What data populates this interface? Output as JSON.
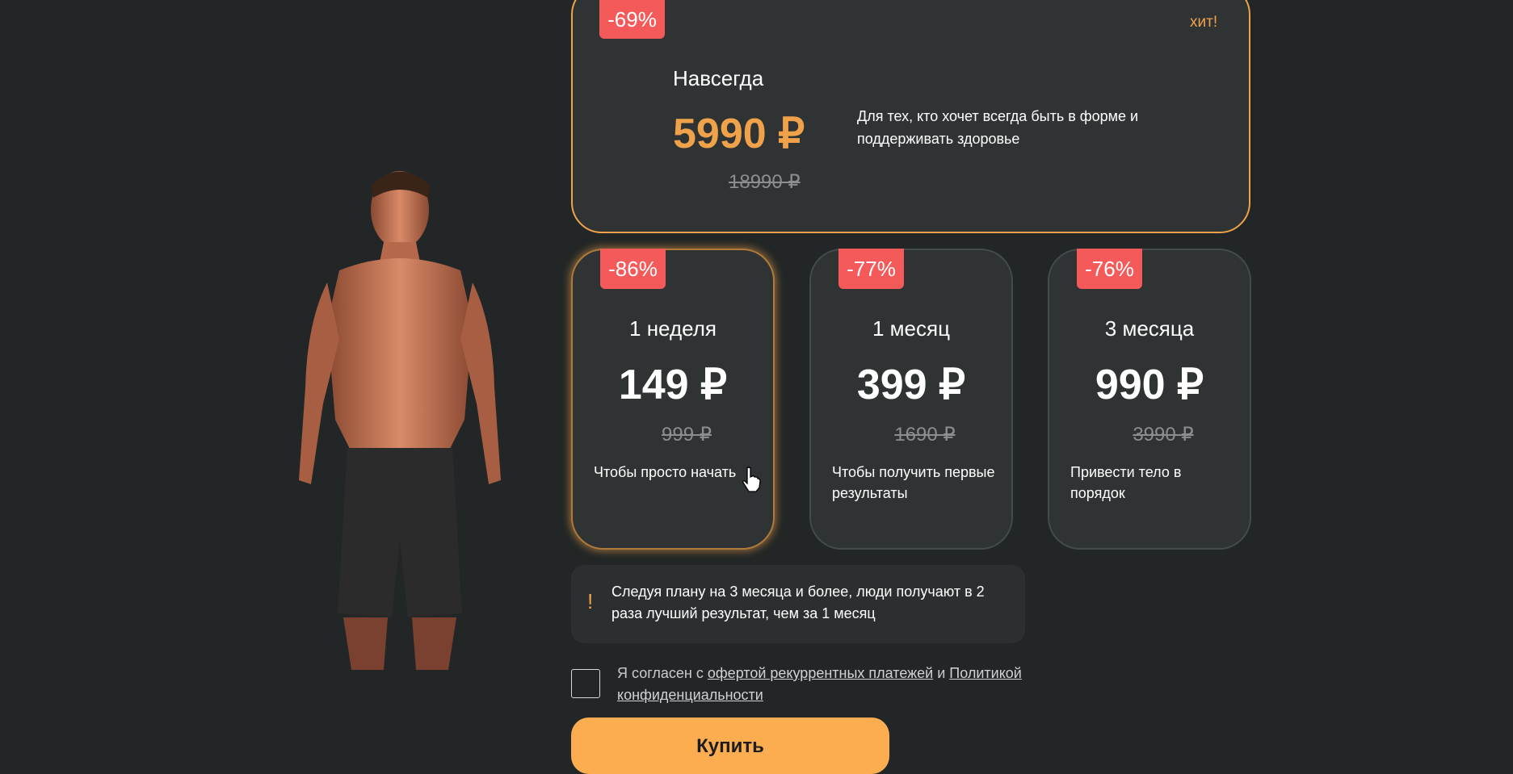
{
  "featured": {
    "badge": "-69%",
    "tag": "хит!",
    "title": "Навсегда",
    "price": "5990 ₽",
    "old_price": "18990 ₽",
    "description": "Для тех, кто хочет всегда быть в форме и поддерживать здоровье"
  },
  "plans": [
    {
      "badge": "-86%",
      "title": "1 неделя",
      "price": "149 ₽",
      "old_price": "999 ₽",
      "description": "Чтобы просто начать"
    },
    {
      "badge": "-77%",
      "title": "1 месяц",
      "price": "399 ₽",
      "old_price": "1690 ₽",
      "description": "Чтобы получить первые результаты"
    },
    {
      "badge": "-76%",
      "title": "3 месяца",
      "price": "990 ₽",
      "old_price": "3990 ₽",
      "description": "Привести тело в порядок"
    }
  ],
  "info": {
    "icon": "!",
    "text": "Следуя плану на 3 месяца и более, люди получают в 2 раза лучший результат, чем за 1 месяц"
  },
  "consent": {
    "prefix": "Я согласен с ",
    "link1": "офертой рекуррентных платежей",
    "middle": " и ",
    "link2": "Политикой конфиденциальности"
  },
  "buy_label": "Купить",
  "colors": {
    "accent": "#f0a24a",
    "badge": "#f45a5a",
    "button": "#fbad50"
  }
}
